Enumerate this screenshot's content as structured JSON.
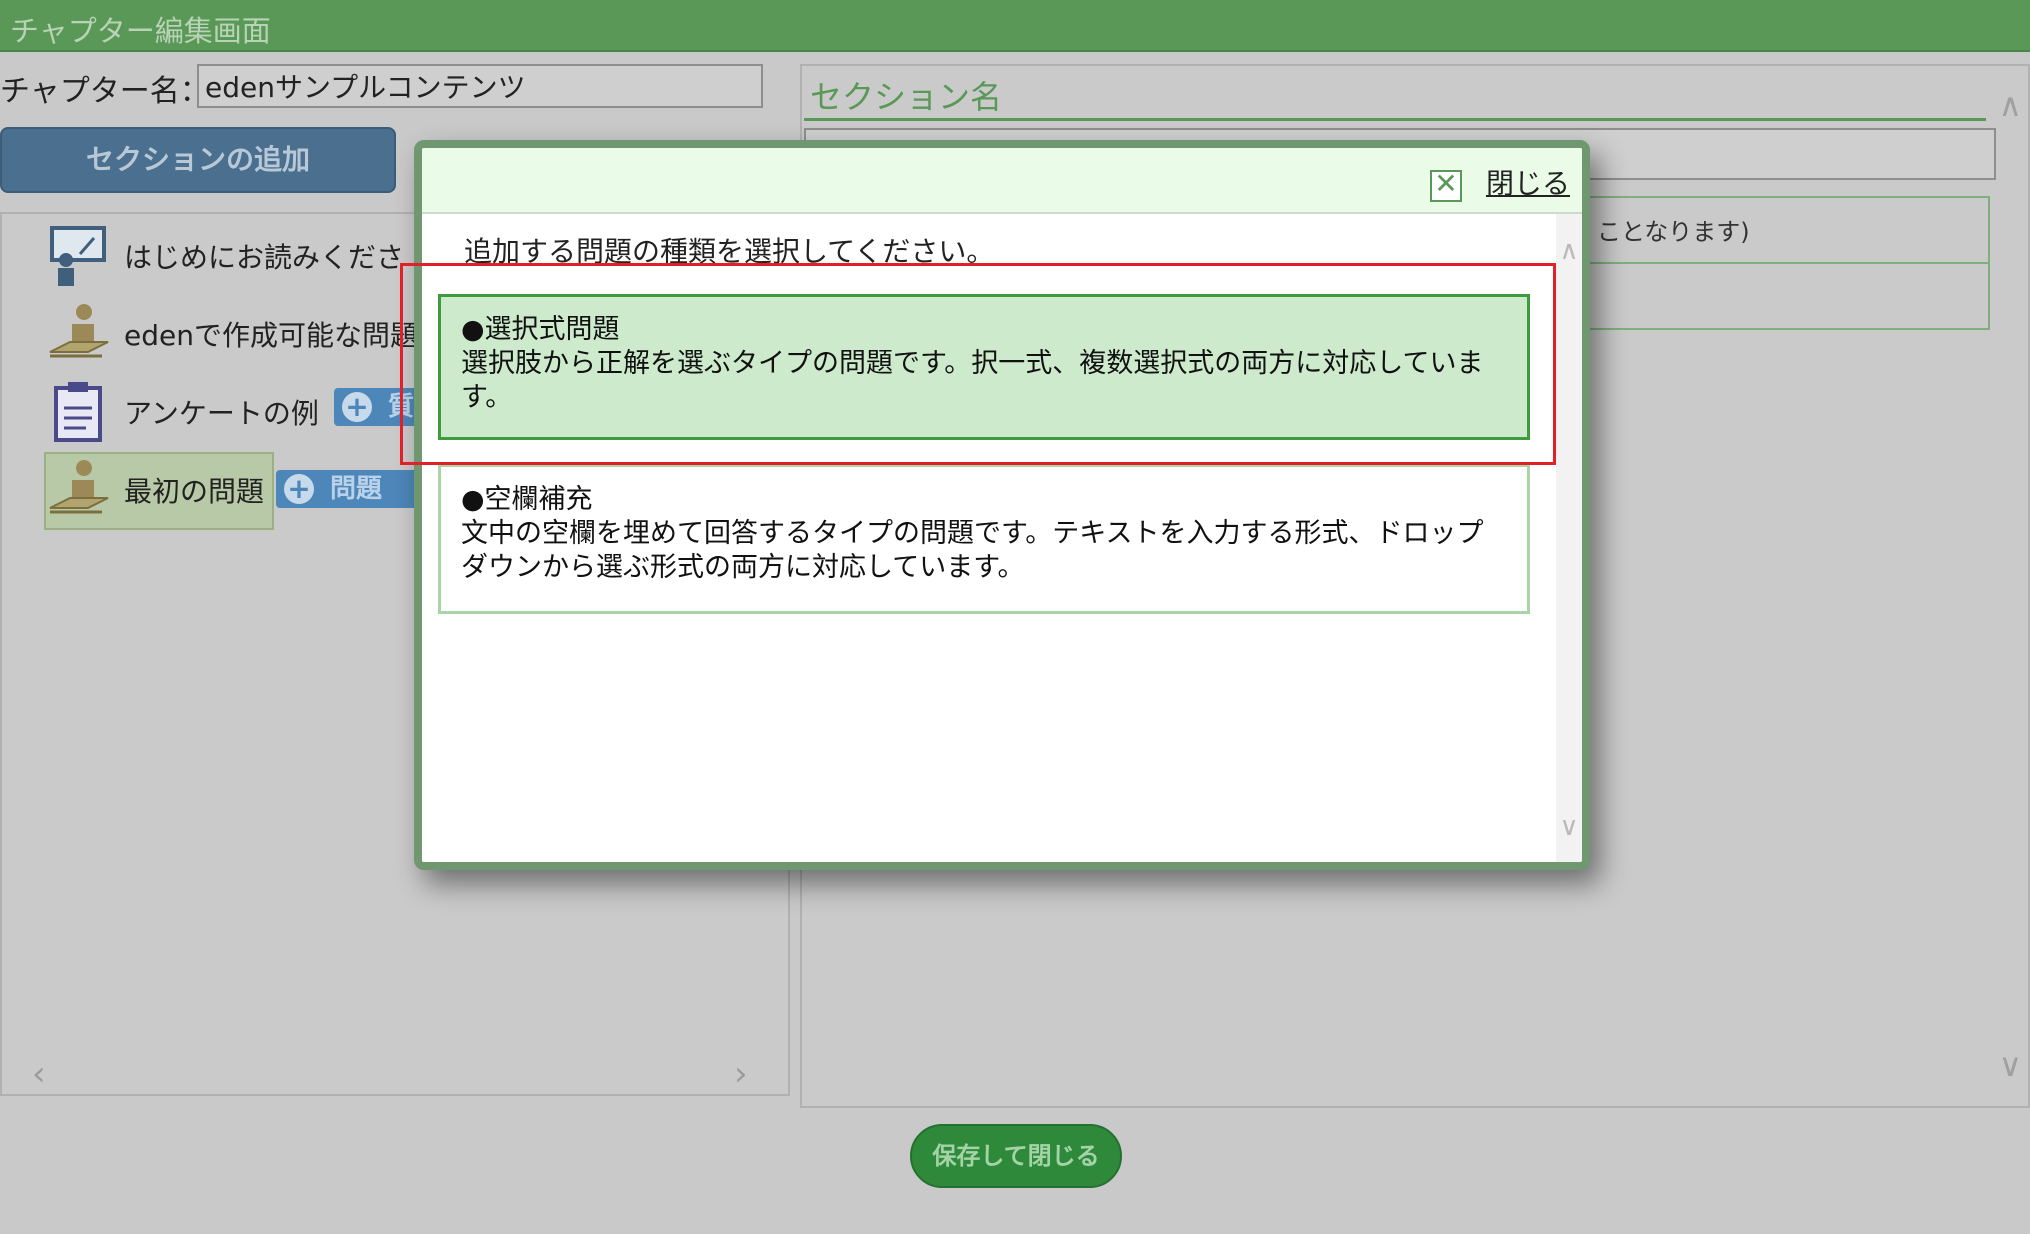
{
  "title": "チャプター編集画面",
  "chapter": {
    "label": "チャプター名：",
    "value": "edenサンプルコンテンツ"
  },
  "add_section_label": "セクションの追加",
  "tree": {
    "items": [
      {
        "label": "はじめにお読みくださ",
        "icon": "presentation-icon"
      },
      {
        "label": "edenで作成可能な問題",
        "icon": "student-desk-icon"
      },
      {
        "label": "アンケートの例",
        "icon": "clipboard-icon",
        "button_label": "質"
      },
      {
        "label": "最初の問題",
        "icon": "student-desk-icon",
        "button_label": "問題"
      }
    ]
  },
  "section": {
    "title": "セクション名",
    "note": "ことなります)"
  },
  "save_label": "保存して閉じる",
  "modal": {
    "close_label": "閉じる",
    "instruction": "追加する問題の種類を選択してください。",
    "options": [
      {
        "title": "●選択式問題",
        "desc": "選択肢から正解を選ぶタイプの問題です。択一式、複数選択式の両方に対応しています。"
      },
      {
        "title": "●空欄補充",
        "desc": "文中の空欄を埋めて回答するタイプの問題です。テキストを入力する形式、ドロップダウンから選ぶ形式の両方に対応しています。"
      }
    ]
  },
  "colors": {
    "accent_green": "#5a9858",
    "highlight_red": "#e12028",
    "selected_option": "#cdebcc"
  }
}
